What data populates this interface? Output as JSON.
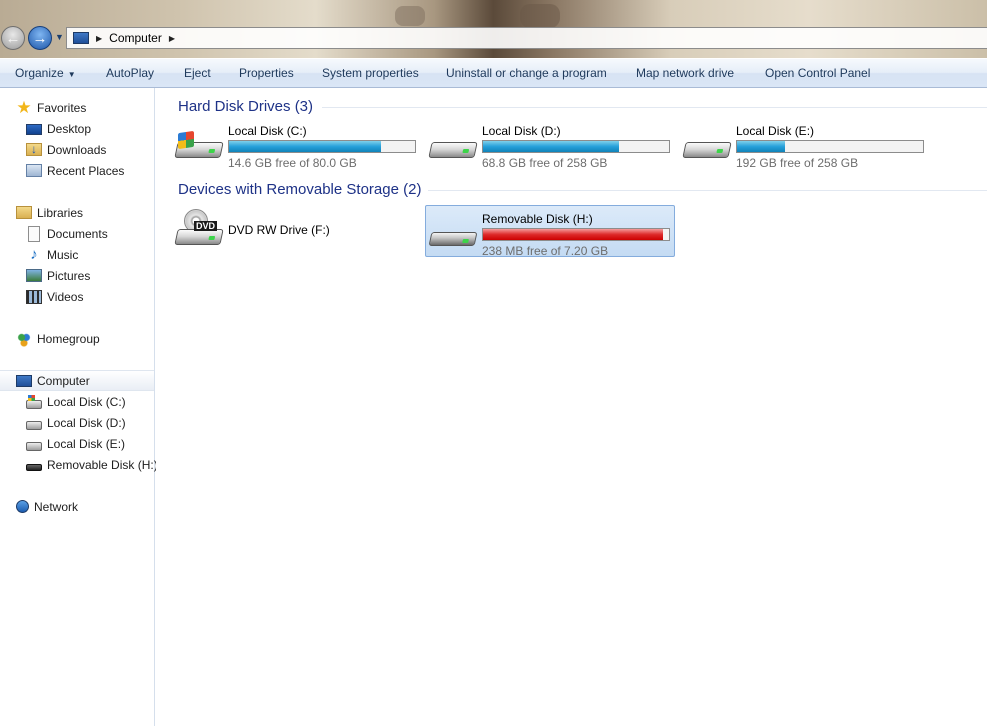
{
  "window": {
    "title": "Computer"
  },
  "address": {
    "path": "Computer"
  },
  "toolbar": {
    "organize": "Organize",
    "autoplay": "AutoPlay",
    "eject": "Eject",
    "properties": "Properties",
    "system_properties": "System properties",
    "uninstall": "Uninstall or change a program",
    "map_drive": "Map network drive",
    "control_panel": "Open Control Panel"
  },
  "nav": {
    "favorites": {
      "label": "Favorites",
      "items": [
        "Desktop",
        "Downloads",
        "Recent Places"
      ]
    },
    "libraries": {
      "label": "Libraries",
      "items": [
        "Documents",
        "Music",
        "Pictures",
        "Videos"
      ]
    },
    "homegroup": "Homegroup",
    "computer": {
      "label": "Computer",
      "items": [
        "Local Disk (C:)",
        "Local Disk (D:)",
        "Local Disk (E:)",
        "Removable Disk (H:)"
      ]
    },
    "network": "Network"
  },
  "groups": [
    {
      "title": "Hard Disk Drives",
      "count": "(3)",
      "drives": [
        {
          "name": "Local Disk (C:)",
          "free": "14.6 GB free of 80.0 GB",
          "used_fraction": 0.8175,
          "state": "normal",
          "icon": "windows-drive-icon"
        },
        {
          "name": "Local Disk (D:)",
          "free": "68.8 GB free of 258 GB",
          "used_fraction": 0.7333,
          "state": "normal",
          "icon": "hard-drive-icon"
        },
        {
          "name": "Local Disk (E:)",
          "free": "192 GB free of 258 GB",
          "used_fraction": 0.2558,
          "state": "normal",
          "icon": "hard-drive-icon"
        }
      ]
    },
    {
      "title": "Devices with Removable Storage",
      "count": "(2)",
      "drives": [
        {
          "name": "DVD RW Drive (F:)",
          "icon": "dvd-drive-icon"
        },
        {
          "name": "Removable Disk (H:)",
          "free": "238 MB free of 7.20 GB",
          "used_fraction": 0.9677,
          "state": "critical",
          "selected": true,
          "icon": "usb-drive-icon"
        }
      ]
    }
  ],
  "colors": {
    "bar_normal": "#26a0da",
    "bar_critical": "#dd2a2a",
    "group_header": "#1e3287",
    "selection": "#c4dbf3"
  }
}
